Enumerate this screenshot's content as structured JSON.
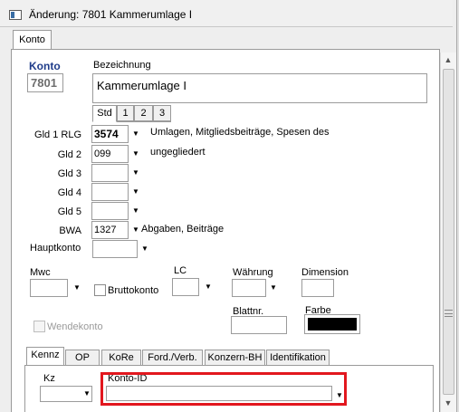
{
  "window": {
    "title": "Änderung: 7801 Kammerumlage I"
  },
  "main_tabs": [
    {
      "label": "Konto"
    }
  ],
  "konto": {
    "label": "Konto",
    "value": "7801"
  },
  "bezeichnung": {
    "label": "Bezeichnung",
    "value": "Kammerumlage I"
  },
  "lang_tabs": [
    {
      "label": "Std"
    },
    {
      "label": "1"
    },
    {
      "label": "2"
    },
    {
      "label": "3"
    }
  ],
  "gld_rows": [
    {
      "label": "Gld 1 RLG",
      "value": "3574",
      "description": "Umlagen, Mitgliedsbeiträge, Spesen des",
      "description2": "ungegliedert"
    },
    {
      "label": "Gld 2",
      "value": "099",
      "description": "ungegliedert"
    },
    {
      "label": "Gld 3",
      "value": ""
    },
    {
      "label": "Gld 4",
      "value": ""
    },
    {
      "label": "Gld 5",
      "value": ""
    },
    {
      "label": "BWA",
      "value": "1327",
      "description": "Abgaben, Beiträge"
    }
  ],
  "hauptkonto": {
    "label": "Hauptkonto",
    "value": ""
  },
  "mwc": {
    "label": "Mwc",
    "value": ""
  },
  "bruttokonto": {
    "label": "Bruttokonto",
    "checked": false
  },
  "lc": {
    "label": "LC",
    "value": ""
  },
  "waehrung": {
    "label": "Währung",
    "value": ""
  },
  "dimension": {
    "label": "Dimension",
    "value": ""
  },
  "blattnr": {
    "label": "Blattnr.",
    "value": ""
  },
  "farbe": {
    "label": "Farbe",
    "color": "#000000"
  },
  "wendekonto": {
    "label": "Wendekonto",
    "checked": false,
    "disabled": true
  },
  "bottom_tabs": [
    {
      "label": "Kennz"
    },
    {
      "label": "OP"
    },
    {
      "label": "KoRe"
    },
    {
      "label": "Ford./Verb."
    },
    {
      "label": "Konzern-BH"
    },
    {
      "label": "Identifikation"
    }
  ],
  "kennz": {
    "kz_label": "Kz",
    "kz_value": "",
    "konto_id_label": "Konto-ID",
    "konto_id_value": ""
  },
  "colors": {
    "highlight": "#e2171e",
    "konto_label": "#1f3c8a"
  }
}
